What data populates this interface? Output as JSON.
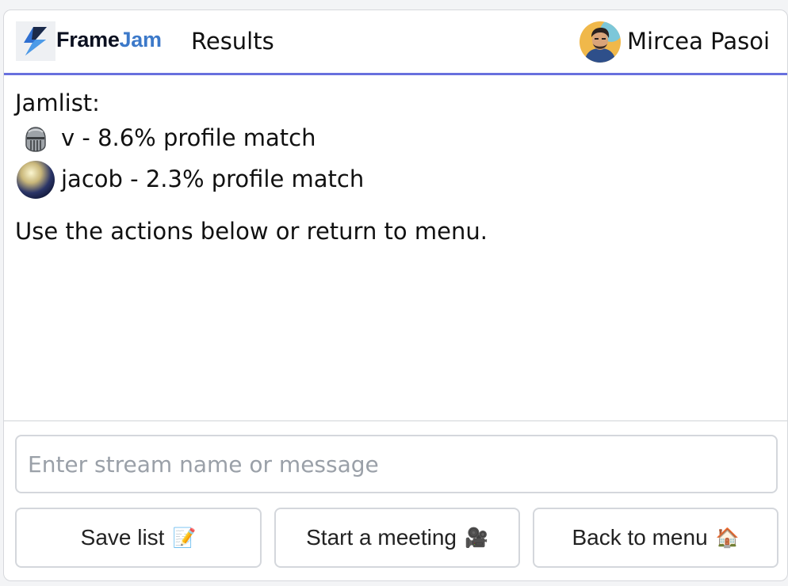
{
  "header": {
    "brand_part1": "Frame",
    "brand_part2": "Jam",
    "title": "Results",
    "user_name": "Mircea Pasoi",
    "accent_color": "#6870de",
    "brand_color": "#3c79c9"
  },
  "content": {
    "heading": "Jamlist:",
    "items": [
      {
        "label": "v - 8.6% profile match",
        "icon": "mask-avatar-icon"
      },
      {
        "label": "jacob - 2.3% profile match",
        "icon": "sphere-avatar-icon"
      }
    ],
    "note": "Use the actions below or return to menu."
  },
  "input": {
    "placeholder": "Enter stream name or message",
    "value": ""
  },
  "buttons": {
    "save": {
      "label": "Save list",
      "emoji": "📝"
    },
    "meeting": {
      "label": "Start a meeting",
      "emoji": "🎥"
    },
    "back": {
      "label": "Back to menu",
      "emoji": "🏠"
    }
  }
}
